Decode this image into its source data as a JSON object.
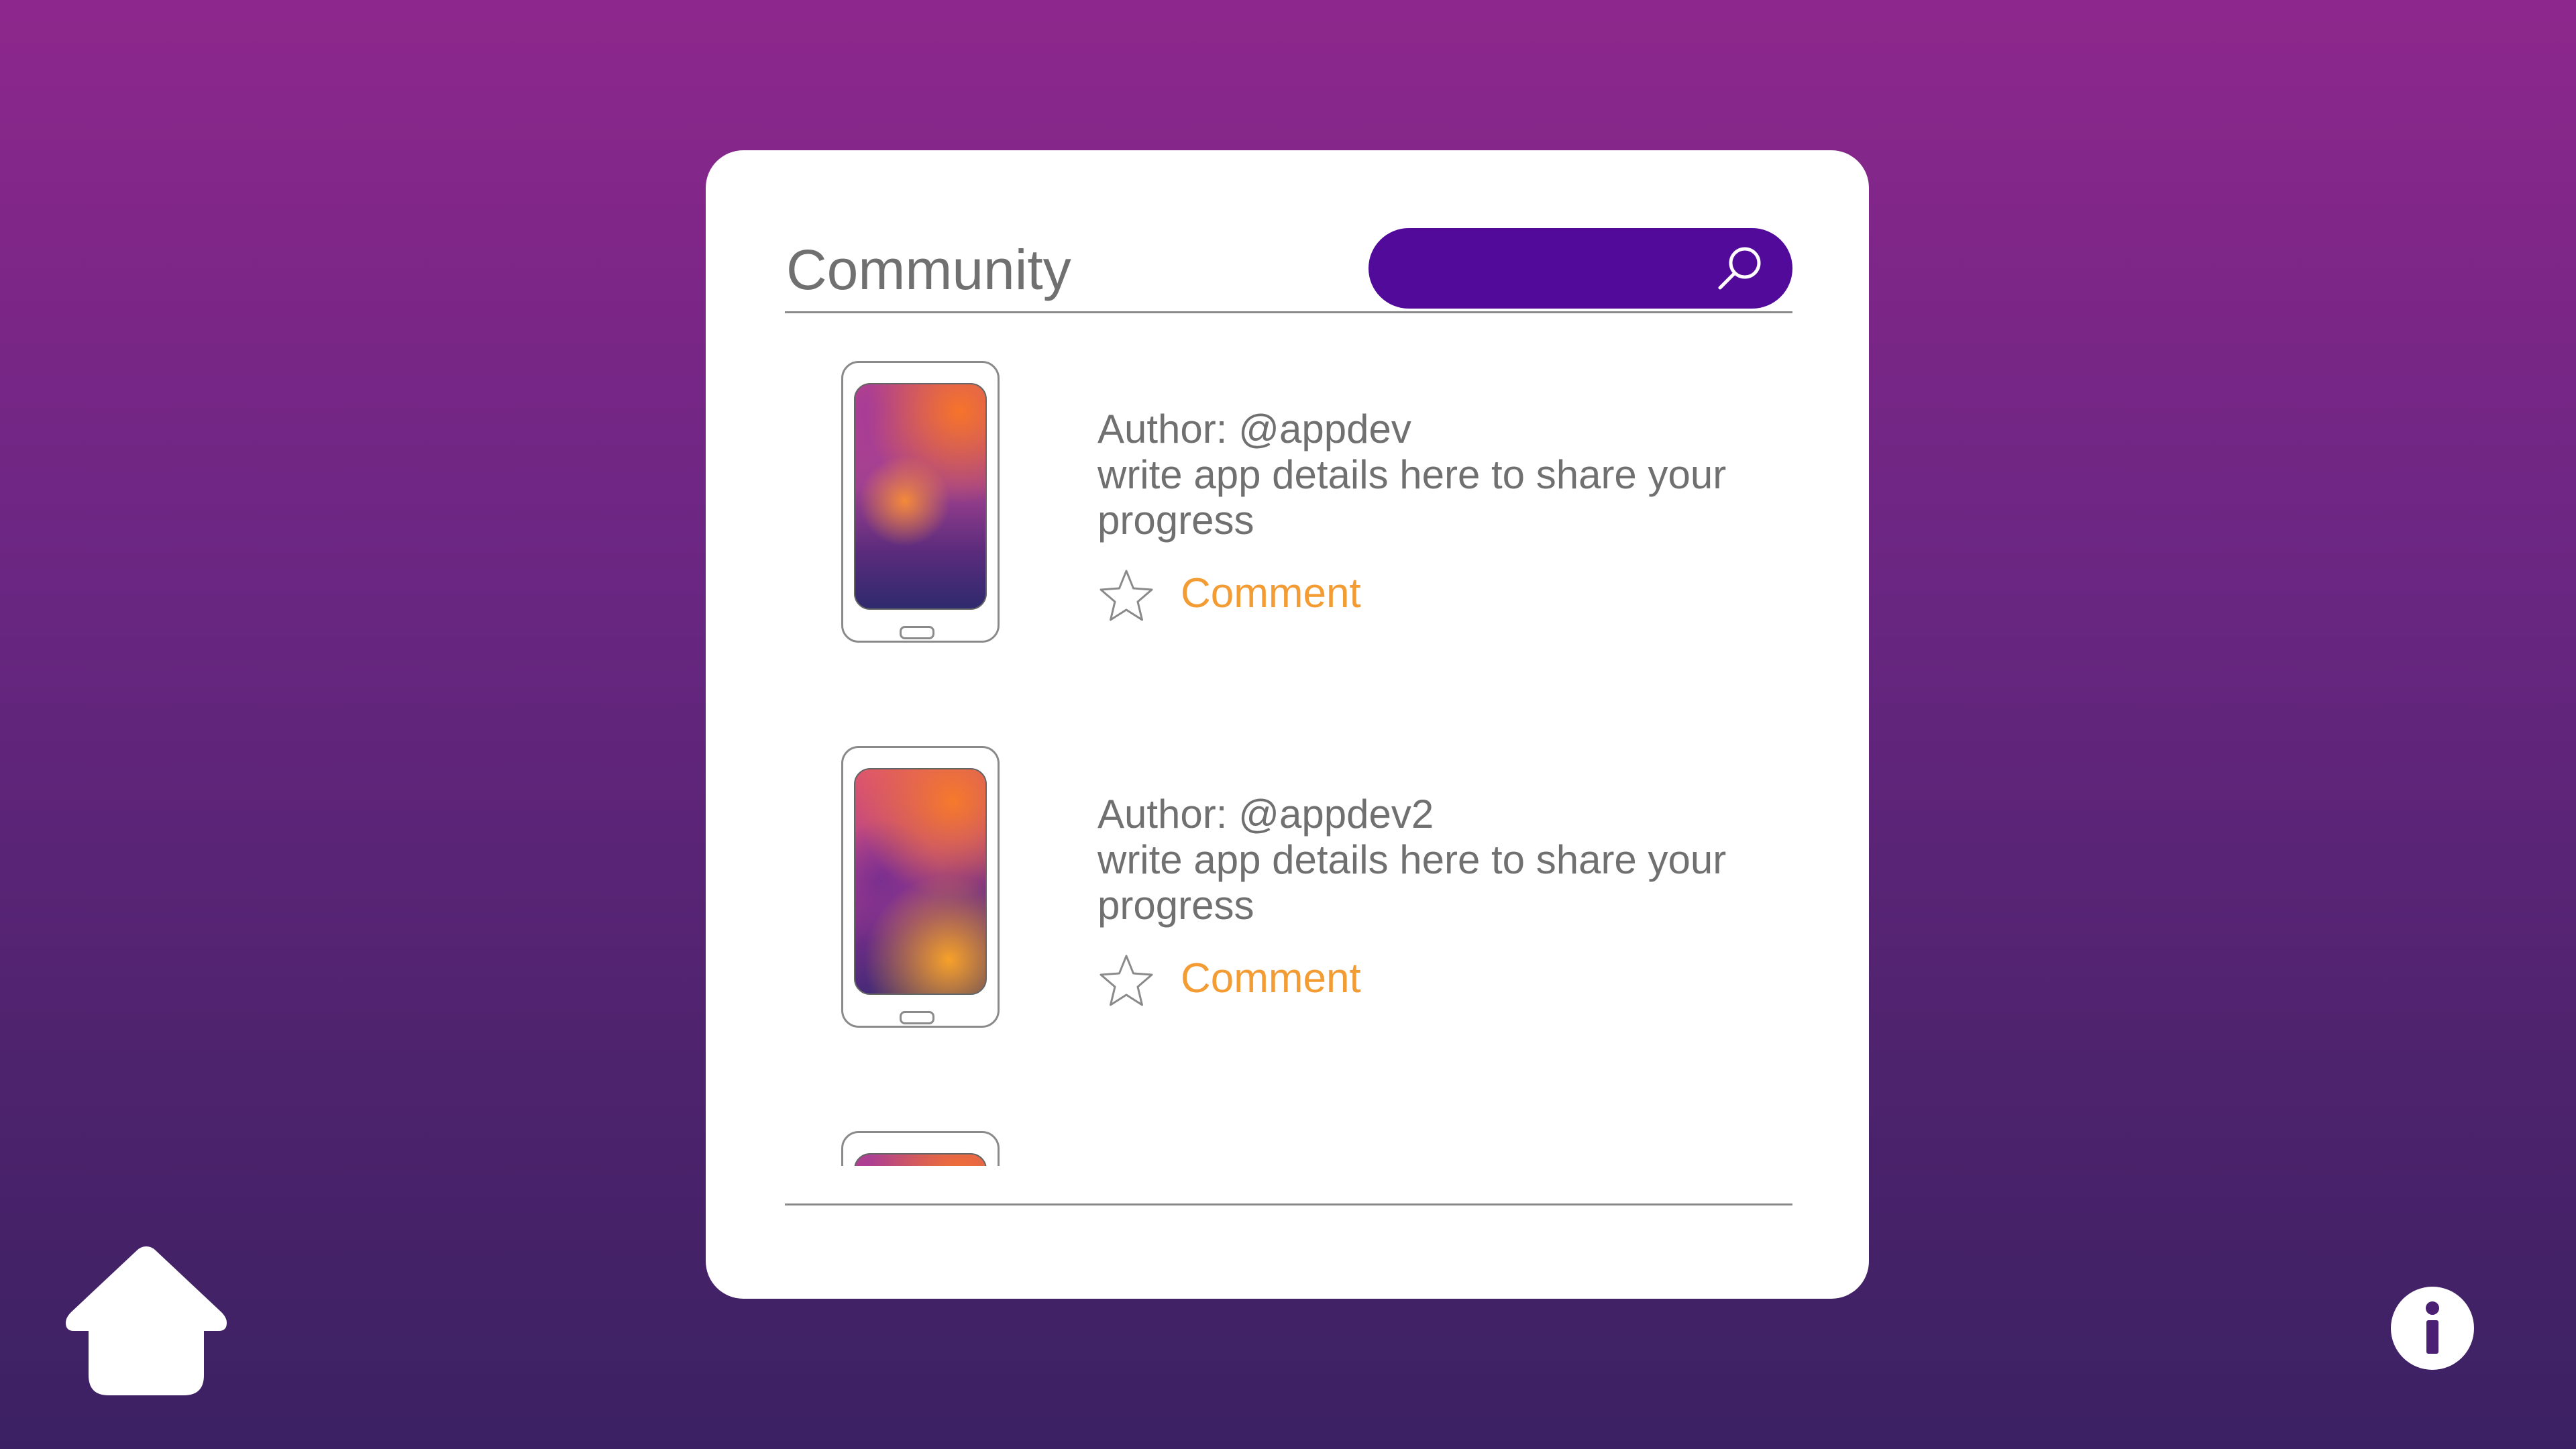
{
  "header": {
    "title": "Community",
    "search_placeholder": ""
  },
  "posts": [
    {
      "author": "Author: @appdev",
      "description": "write app details here to share your progress",
      "comment_label": "Comment"
    },
    {
      "author": "Author: @appdev2",
      "description": "write app details here to share your progress",
      "comment_label": "Comment"
    }
  ],
  "icons": {
    "search": "search-icon",
    "star": "star-icon",
    "home": "home-icon",
    "info": "info-icon"
  },
  "colors": {
    "search_bg": "#520a9b",
    "comment_text": "#f39c34",
    "body_text": "#707070",
    "background_top": "#8e278d",
    "background_bottom": "#3b2163"
  }
}
